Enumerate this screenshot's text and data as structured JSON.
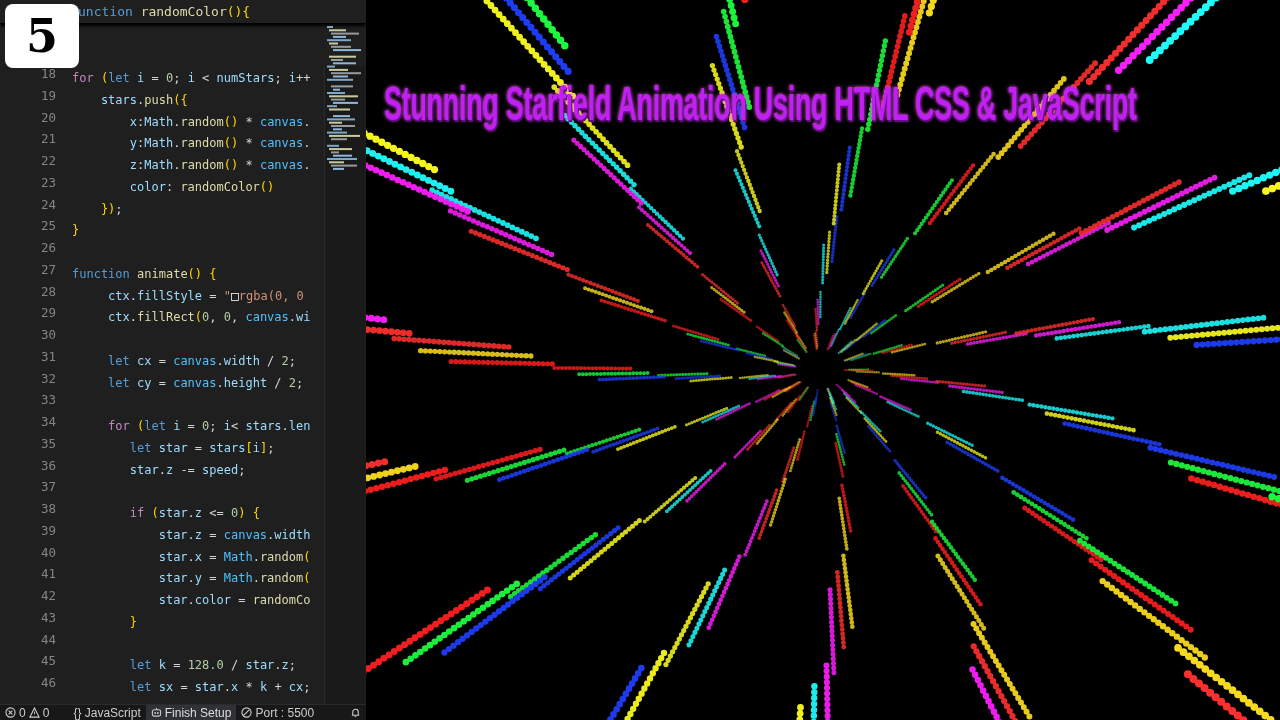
{
  "badge": {
    "text": "5"
  },
  "editor": {
    "sticky_line": [
      {
        "text": "unction ",
        "kind": "kw"
      },
      {
        "text": "randomColor",
        "kind": "fn"
      },
      {
        "text": "(){",
        "kind": "brace"
      }
    ],
    "lines": [
      {
        "number": "18",
        "code": [
          {
            "text": "for",
            "kind": "ctrl"
          },
          {
            "text": " (",
            "kind": "brace"
          },
          {
            "text": "let",
            "kind": "kw"
          },
          {
            "text": " i",
            "kind": "var"
          },
          {
            "text": " = ",
            "kind": "plain"
          },
          {
            "text": "0",
            "kind": "num"
          },
          {
            "text": "; ",
            "kind": "plain"
          },
          {
            "text": "i",
            "kind": "var"
          },
          {
            "text": " < ",
            "kind": "plain"
          },
          {
            "text": "numStars",
            "kind": "var"
          },
          {
            "text": "; ",
            "kind": "plain"
          },
          {
            "text": "i",
            "kind": "var"
          },
          {
            "text": "++",
            "kind": "plain"
          }
        ]
      },
      {
        "number": "19",
        "code": [
          {
            "text": "    stars",
            "kind": "var"
          },
          {
            "text": ".",
            "kind": "plain"
          },
          {
            "text": "push",
            "kind": "fn"
          },
          {
            "text": "({",
            "kind": "brace"
          }
        ]
      },
      {
        "number": "20",
        "code": [
          {
            "text": "        x",
            "kind": "var"
          },
          {
            "text": ":",
            "kind": "plain"
          },
          {
            "text": "Math",
            "kind": "var"
          },
          {
            "text": ".",
            "kind": "plain"
          },
          {
            "text": "random",
            "kind": "fn"
          },
          {
            "text": "()",
            "kind": "brace"
          },
          {
            "text": " * ",
            "kind": "plain"
          },
          {
            "text": "canvas",
            "kind": "prop"
          },
          {
            "text": ".",
            "kind": "plain"
          }
        ]
      },
      {
        "number": "21",
        "code": [
          {
            "text": "        y",
            "kind": "var"
          },
          {
            "text": ":",
            "kind": "plain"
          },
          {
            "text": "Math",
            "kind": "var"
          },
          {
            "text": ".",
            "kind": "plain"
          },
          {
            "text": "random",
            "kind": "fn"
          },
          {
            "text": "()",
            "kind": "brace"
          },
          {
            "text": " * ",
            "kind": "plain"
          },
          {
            "text": "canvas",
            "kind": "prop"
          },
          {
            "text": ".",
            "kind": "plain"
          }
        ]
      },
      {
        "number": "22",
        "code": [
          {
            "text": "        z",
            "kind": "var"
          },
          {
            "text": ":",
            "kind": "plain"
          },
          {
            "text": "Math",
            "kind": "var"
          },
          {
            "text": ".",
            "kind": "plain"
          },
          {
            "text": "random",
            "kind": "fn"
          },
          {
            "text": "()",
            "kind": "brace"
          },
          {
            "text": " * ",
            "kind": "plain"
          },
          {
            "text": "canvas",
            "kind": "prop"
          },
          {
            "text": ".",
            "kind": "plain"
          }
        ]
      },
      {
        "number": "23",
        "code": [
          {
            "text": "        color",
            "kind": "var"
          },
          {
            "text": ": ",
            "kind": "plain"
          },
          {
            "text": "randomColor",
            "kind": "fn"
          },
          {
            "text": "()",
            "kind": "brace"
          }
        ]
      },
      {
        "number": "24",
        "code": [
          {
            "text": "    })",
            "kind": "brace"
          },
          {
            "text": ";",
            "kind": "plain"
          }
        ]
      },
      {
        "number": "25",
        "code": [
          {
            "text": "}",
            "kind": "brace"
          }
        ]
      },
      {
        "number": "26"
      },
      {
        "number": "27",
        "code": [
          {
            "text": "function ",
            "kind": "kw"
          },
          {
            "text": "animate",
            "kind": "fn"
          },
          {
            "text": "() {",
            "kind": "brace"
          }
        ]
      },
      {
        "number": "28",
        "code": [
          {
            "text": "     ctx",
            "kind": "var"
          },
          {
            "text": ".",
            "kind": "plain"
          },
          {
            "text": "fillStyle",
            "kind": "var"
          },
          {
            "text": " = ",
            "kind": "plain"
          },
          {
            "text": "\"",
            "kind": "str"
          },
          {
            "text": "□",
            "kind": "swatch"
          },
          {
            "text": "rgba(0, 0",
            "kind": "str"
          }
        ]
      },
      {
        "number": "29",
        "code": [
          {
            "text": "     ctx",
            "kind": "var"
          },
          {
            "text": ".",
            "kind": "plain"
          },
          {
            "text": "fillRect",
            "kind": "fn"
          },
          {
            "text": "(",
            "kind": "brace"
          },
          {
            "text": "0",
            "kind": "num"
          },
          {
            "text": ", ",
            "kind": "plain"
          },
          {
            "text": "0",
            "kind": "num"
          },
          {
            "text": ", ",
            "kind": "plain"
          },
          {
            "text": "canvas",
            "kind": "prop"
          },
          {
            "text": ".",
            "kind": "plain"
          },
          {
            "text": "wi",
            "kind": "var"
          }
        ]
      },
      {
        "number": "30"
      },
      {
        "number": "31",
        "code": [
          {
            "text": "     let",
            "kind": "kw"
          },
          {
            "text": " cx",
            "kind": "var"
          },
          {
            "text": " = ",
            "kind": "plain"
          },
          {
            "text": "canvas",
            "kind": "prop"
          },
          {
            "text": ".",
            "kind": "plain"
          },
          {
            "text": "width",
            "kind": "var"
          },
          {
            "text": " / ",
            "kind": "plain"
          },
          {
            "text": "2",
            "kind": "num"
          },
          {
            "text": ";",
            "kind": "plain"
          }
        ]
      },
      {
        "number": "32",
        "code": [
          {
            "text": "     let",
            "kind": "kw"
          },
          {
            "text": " cy",
            "kind": "var"
          },
          {
            "text": " = ",
            "kind": "plain"
          },
          {
            "text": "canvas",
            "kind": "prop"
          },
          {
            "text": ".",
            "kind": "plain"
          },
          {
            "text": "height",
            "kind": "var"
          },
          {
            "text": " / ",
            "kind": "plain"
          },
          {
            "text": "2",
            "kind": "num"
          },
          {
            "text": ";",
            "kind": "plain"
          }
        ]
      },
      {
        "number": "33"
      },
      {
        "number": "34",
        "code": [
          {
            "text": "     for",
            "kind": "ctrl"
          },
          {
            "text": " (",
            "kind": "brace"
          },
          {
            "text": "let",
            "kind": "kw"
          },
          {
            "text": " i",
            "kind": "var"
          },
          {
            "text": " = ",
            "kind": "plain"
          },
          {
            "text": "0",
            "kind": "num"
          },
          {
            "text": "; ",
            "kind": "plain"
          },
          {
            "text": "i",
            "kind": "var"
          },
          {
            "text": "< ",
            "kind": "plain"
          },
          {
            "text": "stars",
            "kind": "var"
          },
          {
            "text": ".",
            "kind": "plain"
          },
          {
            "text": "len",
            "kind": "var"
          }
        ]
      },
      {
        "number": "35",
        "code": [
          {
            "text": "        let",
            "kind": "kw"
          },
          {
            "text": " star",
            "kind": "var"
          },
          {
            "text": " = ",
            "kind": "plain"
          },
          {
            "text": "stars",
            "kind": "var"
          },
          {
            "text": "[",
            "kind": "brace"
          },
          {
            "text": "i",
            "kind": "var"
          },
          {
            "text": "]",
            "kind": "brace"
          },
          {
            "text": ";",
            "kind": "plain"
          }
        ]
      },
      {
        "number": "36",
        "code": [
          {
            "text": "        star",
            "kind": "var"
          },
          {
            "text": ".",
            "kind": "plain"
          },
          {
            "text": "z",
            "kind": "var"
          },
          {
            "text": " -= ",
            "kind": "plain"
          },
          {
            "text": "speed",
            "kind": "var"
          },
          {
            "text": ";",
            "kind": "plain"
          }
        ]
      },
      {
        "number": "37"
      },
      {
        "number": "38",
        "code": [
          {
            "text": "        if",
            "kind": "ctrl"
          },
          {
            "text": " (",
            "kind": "brace"
          },
          {
            "text": "star",
            "kind": "var"
          },
          {
            "text": ".",
            "kind": "plain"
          },
          {
            "text": "z",
            "kind": "var"
          },
          {
            "text": " <= ",
            "kind": "plain"
          },
          {
            "text": "0",
            "kind": "num"
          },
          {
            "text": ") {",
            "kind": "brace"
          }
        ]
      },
      {
        "number": "39",
        "code": [
          {
            "text": "            star",
            "kind": "var"
          },
          {
            "text": ".",
            "kind": "plain"
          },
          {
            "text": "z",
            "kind": "var"
          },
          {
            "text": " = ",
            "kind": "plain"
          },
          {
            "text": "canvas",
            "kind": "prop"
          },
          {
            "text": ".",
            "kind": "plain"
          },
          {
            "text": "width",
            "kind": "var"
          }
        ]
      },
      {
        "number": "40",
        "code": [
          {
            "text": "            star",
            "kind": "var"
          },
          {
            "text": ".",
            "kind": "plain"
          },
          {
            "text": "x",
            "kind": "var"
          },
          {
            "text": " = ",
            "kind": "plain"
          },
          {
            "text": "Math",
            "kind": "prop"
          },
          {
            "text": ".",
            "kind": "plain"
          },
          {
            "text": "random",
            "kind": "fn"
          },
          {
            "text": "(",
            "kind": "brace"
          }
        ]
      },
      {
        "number": "41",
        "code": [
          {
            "text": "            star",
            "kind": "var"
          },
          {
            "text": ".",
            "kind": "plain"
          },
          {
            "text": "y",
            "kind": "var"
          },
          {
            "text": " = ",
            "kind": "plain"
          },
          {
            "text": "Math",
            "kind": "prop"
          },
          {
            "text": ".",
            "kind": "plain"
          },
          {
            "text": "random",
            "kind": "fn"
          },
          {
            "text": "(",
            "kind": "brace"
          }
        ]
      },
      {
        "number": "42",
        "code": [
          {
            "text": "            star",
            "kind": "var"
          },
          {
            "text": ".",
            "kind": "plain"
          },
          {
            "text": "color",
            "kind": "var"
          },
          {
            "text": " = ",
            "kind": "plain"
          },
          {
            "text": "randomCo",
            "kind": "fn"
          }
        ]
      },
      {
        "number": "43",
        "code": [
          {
            "text": "        }",
            "kind": "brace"
          }
        ]
      },
      {
        "number": "44"
      },
      {
        "number": "45",
        "code": [
          {
            "text": "        let",
            "kind": "kw"
          },
          {
            "text": " k",
            "kind": "var"
          },
          {
            "text": " = ",
            "kind": "plain"
          },
          {
            "text": "128.0",
            "kind": "num"
          },
          {
            "text": " / ",
            "kind": "plain"
          },
          {
            "text": "star",
            "kind": "var"
          },
          {
            "text": ".",
            "kind": "plain"
          },
          {
            "text": "z",
            "kind": "var"
          },
          {
            "text": ";",
            "kind": "plain"
          }
        ]
      },
      {
        "number": "46",
        "code": [
          {
            "text": "        let",
            "kind": "kw"
          },
          {
            "text": " sx",
            "kind": "var"
          },
          {
            "text": " = ",
            "kind": "plain"
          },
          {
            "text": "star",
            "kind": "var"
          },
          {
            "text": ".",
            "kind": "plain"
          },
          {
            "text": "x",
            "kind": "var"
          },
          {
            "text": " * ",
            "kind": "plain"
          },
          {
            "text": "k",
            "kind": "var"
          },
          {
            "text": " + ",
            "kind": "plain"
          },
          {
            "text": "cx",
            "kind": "var"
          },
          {
            "text": ";",
            "kind": "plain"
          }
        ]
      }
    ]
  },
  "status_bar": [
    {
      "kind": "errors",
      "text": "0"
    },
    {
      "kind": "warnings",
      "text": "0"
    },
    {
      "kind": "language",
      "text": "{} JavaScript"
    },
    {
      "kind": "setup",
      "text": "Finish Setup"
    },
    {
      "kind": "port",
      "text": "Port : 5500"
    },
    {
      "kind": "bell"
    }
  ],
  "preview": {
    "title": "Stunning Starfield Animation Using HTML CSS & JavaScript"
  }
}
